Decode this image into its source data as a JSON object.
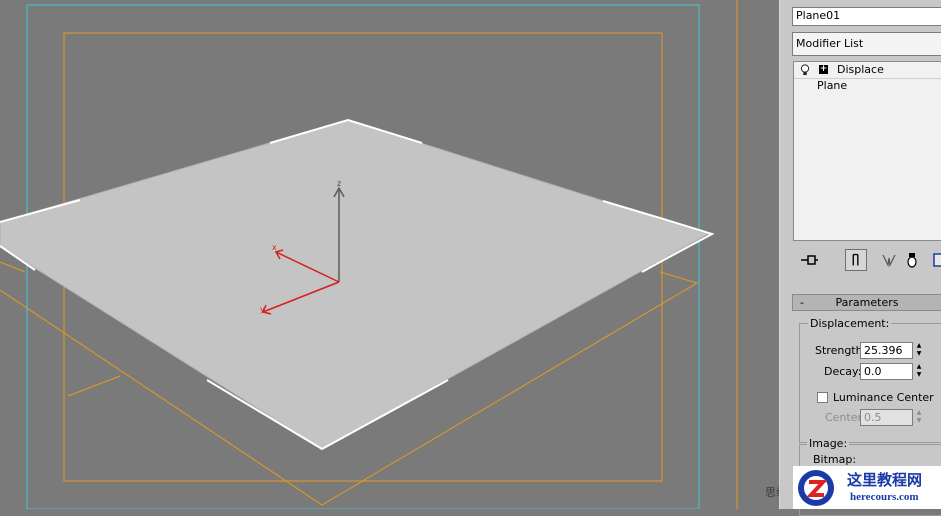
{
  "viewport": {
    "axis_labels": {
      "z": "z",
      "x": "x",
      "y": "y"
    },
    "watermark": "思缘"
  },
  "command_panel": {
    "object_name": "Plane01",
    "modifier_list": "Modifier List",
    "stack": [
      {
        "label": "Displace",
        "icon": "lightbulb-icon",
        "expand": "+"
      },
      {
        "label": "Plane"
      }
    ],
    "toolbar_icons": [
      "pin-stack-icon",
      "show-end-result-icon",
      "make-unique-icon",
      "remove-modifier-icon",
      "configure-sets-icon"
    ],
    "parameters": {
      "title": "Parameters",
      "collapse": "-",
      "displacement": {
        "group": "Displacement:",
        "strength_label": "Strength:",
        "strength_value": "25.396",
        "decay_label": "Decay:",
        "decay_value": "0.0",
        "luminance_center_label": "Luminance Center",
        "luminance_center_checked": false,
        "center_label": "Center:",
        "center_value": "0.5"
      },
      "image": {
        "group": "Image:",
        "bitmap_label": "Bitmap:"
      }
    }
  },
  "logo": {
    "cn": "这里教程网",
    "en": "herecours.com"
  },
  "colors": {
    "viewport_bg": "#7a7a7a",
    "plane_fill": "#c4c4c4",
    "safe_frame_cyan": "#3ecbd6",
    "safe_frame_orange": "#e59a1e",
    "axis_red": "#d61f1f",
    "panel_bg": "#c8c8c8"
  }
}
